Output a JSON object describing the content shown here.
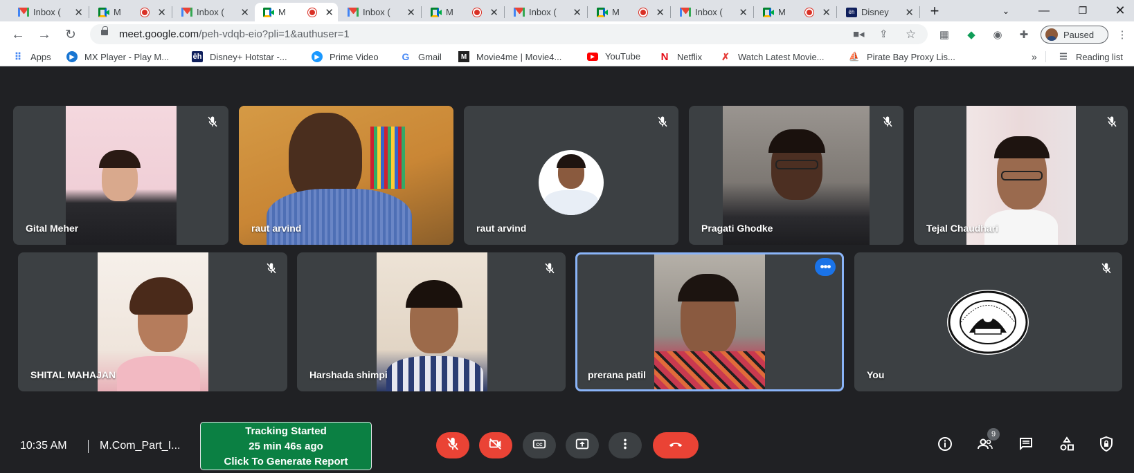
{
  "browser": {
    "tabs": [
      {
        "title": "Inbox (",
        "icon": "gmail-icon"
      },
      {
        "title": "M",
        "icon": "meet-icon",
        "recording": true
      },
      {
        "title": "Inbox (",
        "icon": "gmail-icon"
      },
      {
        "title": "M",
        "icon": "meet-icon",
        "recording": true,
        "active": true
      },
      {
        "title": "Inbox (",
        "icon": "gmail-icon"
      },
      {
        "title": "M",
        "icon": "meet-icon",
        "recording": true
      },
      {
        "title": "Inbox (",
        "icon": "gmail-icon"
      },
      {
        "title": "M",
        "icon": "meet-icon",
        "recording": true
      },
      {
        "title": "Inbox (",
        "icon": "gmail-icon"
      },
      {
        "title": "M",
        "icon": "meet-icon",
        "recording": true
      },
      {
        "title": "Disney",
        "icon": "hotstar-icon"
      }
    ],
    "new_tab": "+",
    "address": {
      "host": "meet.google.com",
      "path": "/peh-vdqb-eio?pli=1&authuser=1"
    },
    "profile_status": "Paused",
    "bookmarks": [
      {
        "label": "Apps"
      },
      {
        "label": "MX Player - Play M..."
      },
      {
        "label": "Disney+ Hotstar -..."
      },
      {
        "label": "Prime Video"
      },
      {
        "label": "Gmail"
      },
      {
        "label": "Movie4me | Movie4..."
      },
      {
        "label": "YouTube"
      },
      {
        "label": "Netflix"
      },
      {
        "label": "Watch Latest Movie..."
      },
      {
        "label": "Pirate Bay Proxy Lis..."
      }
    ],
    "bookmarks_more": "»",
    "reading_list": "Reading list"
  },
  "meet": {
    "participants": [
      {
        "name": "Gital Meher"
      },
      {
        "name": "raut arvind"
      },
      {
        "name": "raut arvind"
      },
      {
        "name": "Pragati Ghodke"
      },
      {
        "name": "Tejal Chaudhari"
      },
      {
        "name": "SHITAL MAHAJAN"
      },
      {
        "name": "Harshada shimpi"
      },
      {
        "name": "prerana patil"
      },
      {
        "name": "You"
      }
    ],
    "more_options": "•••",
    "time": "10:35 AM",
    "meeting_code": "M.Com_Part_I...",
    "tracking": {
      "line1": "Tracking Started",
      "line2": "25 min 46s ago",
      "line3": "Click To Generate Report"
    },
    "people_count": "9"
  },
  "colors": {
    "end_call": "#ea4335",
    "tracking_bg": "#0b8043",
    "highlight": "#8ab4f8"
  }
}
